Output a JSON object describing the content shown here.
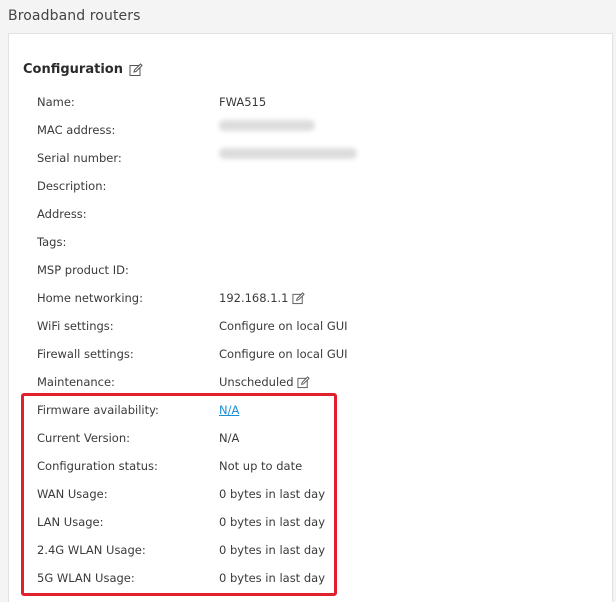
{
  "page": {
    "title": "Broadband routers"
  },
  "configuration": {
    "title": "Configuration",
    "rows": [
      {
        "label": "Name:",
        "value": "FWA515"
      },
      {
        "label": "MAC address:",
        "value": ""
      },
      {
        "label": "Serial number:",
        "value": ""
      },
      {
        "label": "Description:",
        "value": ""
      },
      {
        "label": "Address:",
        "value": ""
      },
      {
        "label": "Tags:",
        "value": ""
      },
      {
        "label": "MSP product ID:",
        "value": ""
      },
      {
        "label": "Home networking:",
        "value": "192.168.1.1"
      },
      {
        "label": "WiFi settings:",
        "value": "Configure on local GUI"
      },
      {
        "label": "Firewall settings:",
        "value": "Configure on local GUI"
      },
      {
        "label": "Maintenance:",
        "value": "Unscheduled"
      },
      {
        "label": "Firmware availability:",
        "value": "N/A"
      },
      {
        "label": "Current Version:",
        "value": "N/A"
      },
      {
        "label": "Configuration status:",
        "value": "Not up to date"
      },
      {
        "label": "WAN Usage:",
        "value": "0 bytes in last day"
      },
      {
        "label": "LAN Usage:",
        "value": "0 bytes in last day"
      },
      {
        "label": "2.4G WLAN Usage:",
        "value": "0 bytes in last day"
      },
      {
        "label": "5G WLAN Usage:",
        "value": "0 bytes in last day"
      }
    ]
  },
  "colors": {
    "link": "#1a8fd8",
    "highlight": "#e0202c"
  }
}
